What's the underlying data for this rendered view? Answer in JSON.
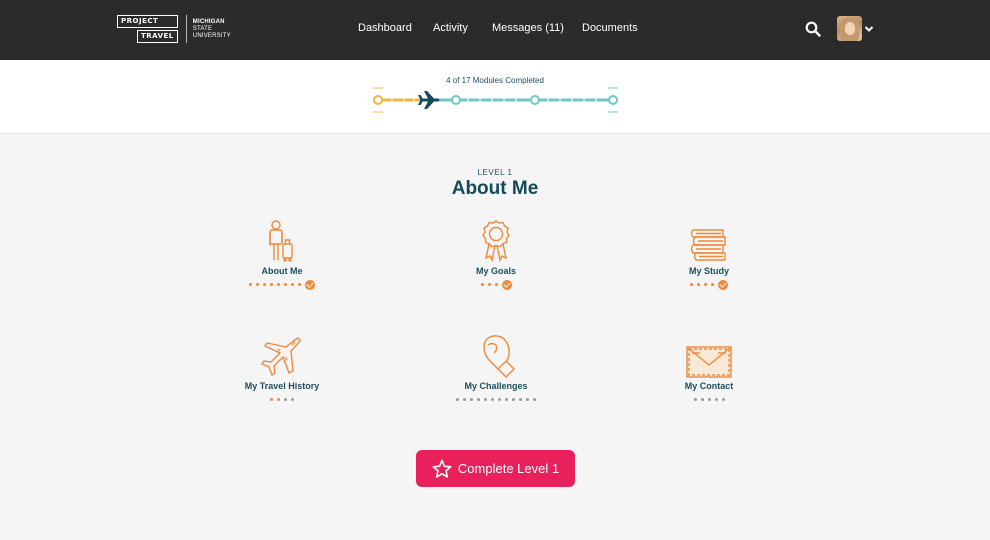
{
  "brand": {
    "logo_line1": "PROJECT",
    "logo_line2": "TRAVEL",
    "university": [
      "MICHIGAN",
      "STATE",
      "UNIVERSITY"
    ]
  },
  "nav": {
    "items": [
      {
        "label": "Dashboard"
      },
      {
        "label": "Activity"
      },
      {
        "label": "Messages (11)"
      },
      {
        "label": "Documents"
      }
    ],
    "icons": {
      "search": "search-icon",
      "menu": "chevron-down-icon"
    }
  },
  "progress": {
    "text": "4 of 17 Modules Completed",
    "completed": 4,
    "total": 17,
    "colors": {
      "done": "#f4b53f",
      "remaining": "#6cc9c7",
      "plane": "#164a5b"
    }
  },
  "level": {
    "label": "LEVEL 1",
    "title": "About Me"
  },
  "modules": [
    {
      "label": "About Me",
      "icon": "traveler-icon",
      "done": 8,
      "remaining": 0,
      "complete": true
    },
    {
      "label": "My Goals",
      "icon": "award-ribbon-icon",
      "done": 3,
      "remaining": 0,
      "complete": true
    },
    {
      "label": "My Study",
      "icon": "books-icon",
      "done": 4,
      "remaining": 0,
      "complete": true
    },
    {
      "label": "My Travel History",
      "icon": "airplane-icon",
      "done": 2,
      "remaining": 2,
      "complete": false
    },
    {
      "label": "My Challenges",
      "icon": "boxing-glove-icon",
      "done": 0,
      "remaining": 12,
      "complete": false
    },
    {
      "label": "My Contact",
      "icon": "envelope-icon",
      "done": 0,
      "remaining": 5,
      "complete": false
    }
  ],
  "actions": {
    "complete_label": "Complete Level 1",
    "accent": "#e8215d",
    "icon_color": "#ef8a3c"
  }
}
